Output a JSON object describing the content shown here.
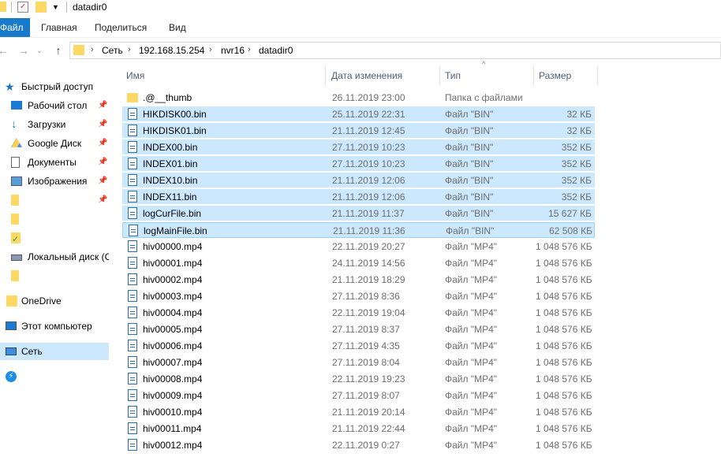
{
  "window": {
    "title": "datadir0"
  },
  "ribbon": {
    "tabs": [
      "Файл",
      "Главная",
      "Поделиться",
      "Вид"
    ]
  },
  "address": {
    "crumbs": [
      "Сеть",
      "192.168.15.254",
      "nvr16",
      "datadir0"
    ]
  },
  "sidebar": {
    "items": [
      {
        "label": "Быстрый доступ",
        "icon": "star-icon",
        "pinned": false
      },
      {
        "label": "Рабочий стол",
        "icon": "desktop-icon",
        "pinned": true
      },
      {
        "label": "Загрузки",
        "icon": "download-icon",
        "pinned": true
      },
      {
        "label": "Google Диск",
        "icon": "google-drive-icon",
        "pinned": true
      },
      {
        "label": "Документы",
        "icon": "document-icon",
        "pinned": true
      },
      {
        "label": "Изображения",
        "icon": "pictures-icon",
        "pinned": true
      },
      {
        "label": "",
        "icon": "folder-icon",
        "pinned": true
      },
      {
        "label": "",
        "icon": "folder-icon",
        "pinned": false
      },
      {
        "label": "",
        "icon": "folder-check-icon",
        "pinned": false
      },
      {
        "label": "Локальный диск (C",
        "icon": "drive-icon",
        "pinned": false
      },
      {
        "label": "",
        "icon": "folder-icon",
        "pinned": false
      },
      {
        "label": "OneDrive",
        "icon": "folder-icon",
        "pinned": false
      },
      {
        "label": "Этот компьютер",
        "icon": "computer-icon",
        "pinned": false
      },
      {
        "label": "Сеть",
        "icon": "network-icon",
        "pinned": false
      },
      {
        "label": "",
        "icon": "bolt-icon",
        "pinned": false
      }
    ]
  },
  "columns": {
    "name": "Имя",
    "date": "Дата изменения",
    "type": "Тип",
    "size": "Размер"
  },
  "files": [
    {
      "name": ".@__thumb",
      "date": "26.11.2019 23:00",
      "type": "Папка с файлами",
      "size": "",
      "kind": "folder",
      "selected": false
    },
    {
      "name": "HIKDISK00.bin",
      "date": "25.11.2019 22:31",
      "type": "Файл \"BIN\"",
      "size": "32 КБ",
      "kind": "file",
      "selected": true
    },
    {
      "name": "HIKDISK01.bin",
      "date": "21.11.2019 12:45",
      "type": "Файл \"BIN\"",
      "size": "32 КБ",
      "kind": "file",
      "selected": true
    },
    {
      "name": "INDEX00.bin",
      "date": "27.11.2019 10:23",
      "type": "Файл \"BIN\"",
      "size": "352 КБ",
      "kind": "file",
      "selected": true
    },
    {
      "name": "INDEX01.bin",
      "date": "27.11.2019 10:23",
      "type": "Файл \"BIN\"",
      "size": "352 КБ",
      "kind": "file",
      "selected": true
    },
    {
      "name": "INDEX10.bin",
      "date": "21.11.2019 12:06",
      "type": "Файл \"BIN\"",
      "size": "352 КБ",
      "kind": "file",
      "selected": true
    },
    {
      "name": "INDEX11.bin",
      "date": "21.11.2019 12:06",
      "type": "Файл \"BIN\"",
      "size": "352 КБ",
      "kind": "file",
      "selected": true
    },
    {
      "name": "logCurFile.bin",
      "date": "21.11.2019 11:37",
      "type": "Файл \"BIN\"",
      "size": "15 627 КБ",
      "kind": "file",
      "selected": true
    },
    {
      "name": "logMainFile.bin",
      "date": "21.11.2019 11:36",
      "type": "Файл \"BIN\"",
      "size": "62 508 КБ",
      "kind": "file",
      "selected": true,
      "focused": true
    },
    {
      "name": "hiv00000.mp4",
      "date": "22.11.2019 20:27",
      "type": "Файл \"MP4\"",
      "size": "1 048 576 КБ",
      "kind": "file",
      "selected": false
    },
    {
      "name": "hiv00001.mp4",
      "date": "24.11.2019 14:56",
      "type": "Файл \"MP4\"",
      "size": "1 048 576 КБ",
      "kind": "file",
      "selected": false
    },
    {
      "name": "hiv00002.mp4",
      "date": "21.11.2019 18:29",
      "type": "Файл \"MP4\"",
      "size": "1 048 576 КБ",
      "kind": "file",
      "selected": false
    },
    {
      "name": "hiv00003.mp4",
      "date": "27.11.2019 8:36",
      "type": "Файл \"MP4\"",
      "size": "1 048 576 КБ",
      "kind": "file",
      "selected": false
    },
    {
      "name": "hiv00004.mp4",
      "date": "22.11.2019 19:04",
      "type": "Файл \"MP4\"",
      "size": "1 048 576 КБ",
      "kind": "file",
      "selected": false
    },
    {
      "name": "hiv00005.mp4",
      "date": "27.11.2019 8:37",
      "type": "Файл \"MP4\"",
      "size": "1 048 576 КБ",
      "kind": "file",
      "selected": false
    },
    {
      "name": "hiv00006.mp4",
      "date": "27.11.2019 4:35",
      "type": "Файл \"MP4\"",
      "size": "1 048 576 КБ",
      "kind": "file",
      "selected": false
    },
    {
      "name": "hiv00007.mp4",
      "date": "27.11.2019 8:04",
      "type": "Файл \"MP4\"",
      "size": "1 048 576 КБ",
      "kind": "file",
      "selected": false
    },
    {
      "name": "hiv00008.mp4",
      "date": "22.11.2019 19:23",
      "type": "Файл \"MP4\"",
      "size": "1 048 576 КБ",
      "kind": "file",
      "selected": false
    },
    {
      "name": "hiv00009.mp4",
      "date": "27.11.2019 8:07",
      "type": "Файл \"MP4\"",
      "size": "1 048 576 КБ",
      "kind": "file",
      "selected": false
    },
    {
      "name": "hiv00010.mp4",
      "date": "21.11.2019 20:14",
      "type": "Файл \"MP4\"",
      "size": "1 048 576 КБ",
      "kind": "file",
      "selected": false
    },
    {
      "name": "hiv00011.mp4",
      "date": "21.11.2019 22:44",
      "type": "Файл \"MP4\"",
      "size": "1 048 576 КБ",
      "kind": "file",
      "selected": false
    },
    {
      "name": "hiv00012.mp4",
      "date": "22.11.2019 0:27",
      "type": "Файл \"MP4\"",
      "size": "1 048 576 КБ",
      "kind": "file",
      "selected": false
    }
  ]
}
